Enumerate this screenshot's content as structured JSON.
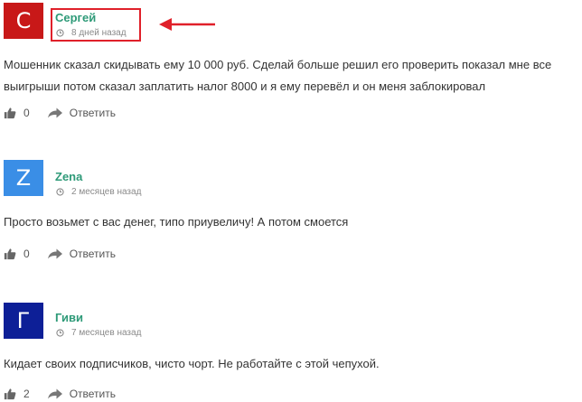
{
  "comments": [
    {
      "avatar_letter": "С",
      "avatar_color": "#c81818",
      "author": "Сергей",
      "time": "8 дней назад",
      "text": "Мошенник сказал скидывать ему 10 000 руб. Сделай больше решил его проверить показал мне все выигрыши потом сказал заплатить налог 8000 и я ему перевёл и он меня заблокировал",
      "likes": "0",
      "reply_label": "Ответить"
    },
    {
      "avatar_letter": "Z",
      "avatar_color": "#3a8ee6",
      "author": "Zena",
      "time": "2 месяцев назад",
      "text": "Просто возьмет с вас денег, типо приувеличу! А потом смоется",
      "likes": "0",
      "reply_label": "Ответить"
    },
    {
      "avatar_letter": "Г",
      "avatar_color": "#0d1f97",
      "author": "Гиви",
      "time": "7 месяцев назад",
      "text": "Кидает своих подписчиков, чисто чорт. Не работайте с этой чепухой.",
      "likes": "2",
      "reply_label": "Ответить"
    }
  ],
  "annotation": {
    "highlight_color": "#e0202a"
  },
  "icons": {
    "time": "clock-icon",
    "like": "thumbs-up-icon",
    "reply": "reply-arrow-icon"
  }
}
